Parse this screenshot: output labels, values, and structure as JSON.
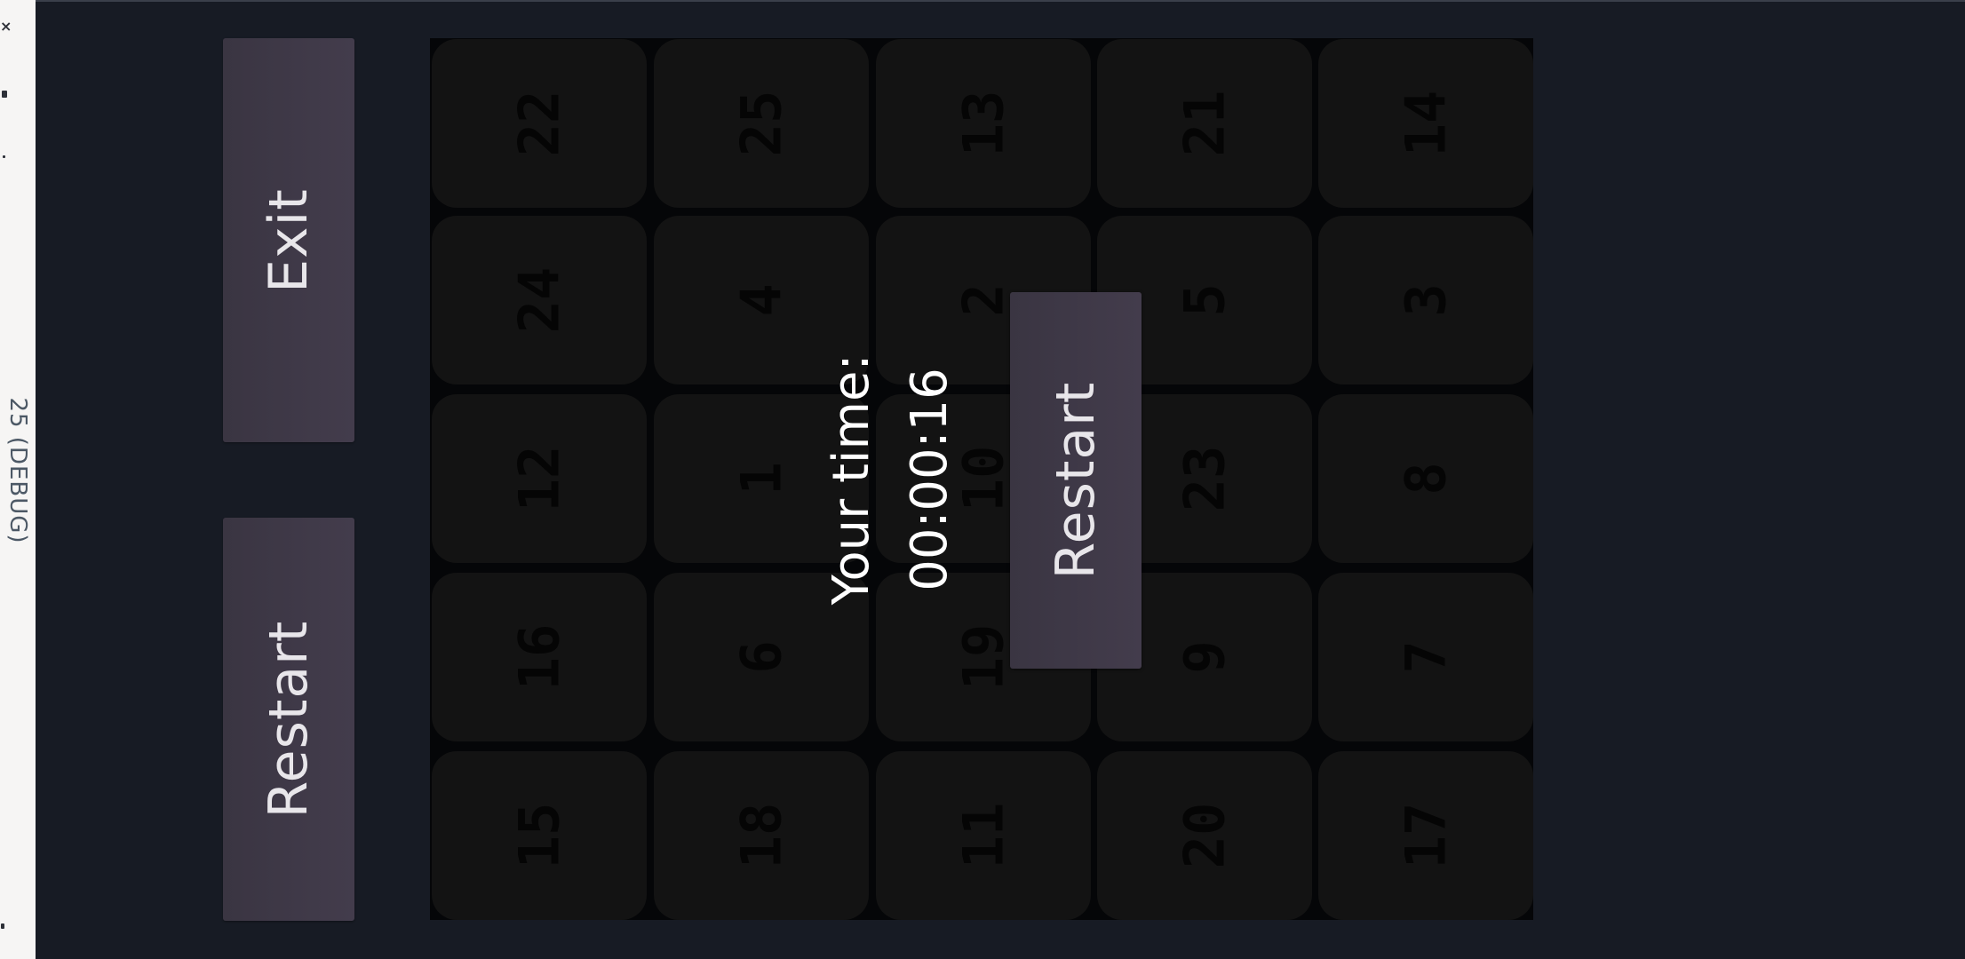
{
  "window": {
    "side_label": "25 (DEBUG)"
  },
  "buttons": {
    "exit_label": "Exit",
    "restart_label": "Restart",
    "overlay_restart_label": "Restart"
  },
  "result": {
    "title": "Your time:",
    "time": "00:00:16"
  },
  "board": {
    "rows": [
      [
        "22",
        "25",
        "13",
        "21",
        "14"
      ],
      [
        "24",
        "4",
        "2",
        "5",
        "3"
      ],
      [
        "12",
        "1",
        "10",
        "23",
        "8"
      ],
      [
        "16",
        "6",
        "19",
        "9",
        "7"
      ],
      [
        "15",
        "18",
        "11",
        "20",
        "17"
      ]
    ]
  },
  "colors": {
    "background": "#171b24",
    "board_background": "#050608",
    "tile": "#131313",
    "tile_number": "#050505",
    "button": "#3f3948",
    "button_text": "#e8e6ea",
    "overlay_text": "#ffffff"
  }
}
